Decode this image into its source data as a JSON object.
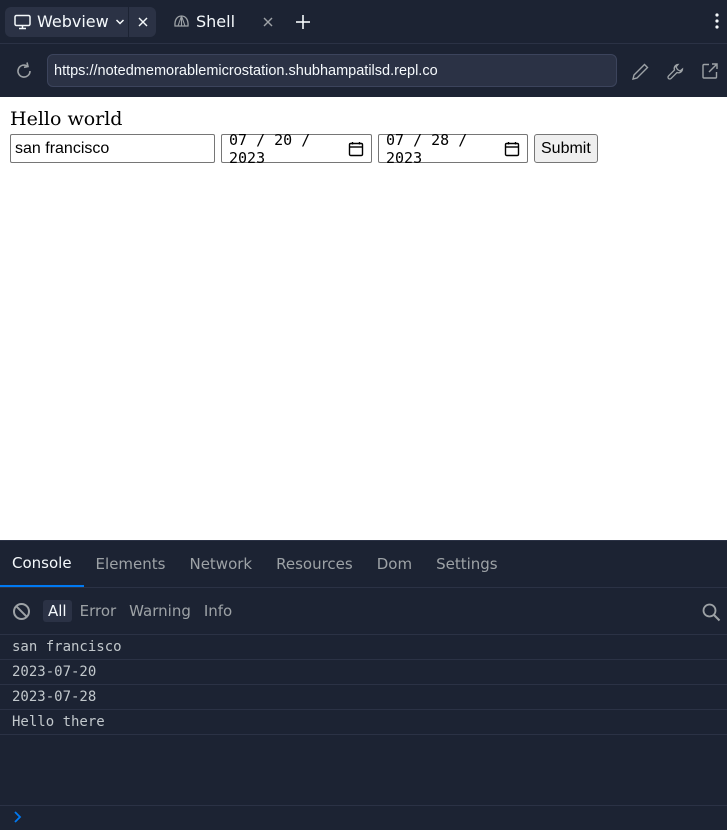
{
  "tabs": [
    {
      "label": "Webview",
      "icon": "monitor-icon",
      "active": true
    },
    {
      "label": "Shell",
      "icon": "shell-icon",
      "active": false
    }
  ],
  "url_bar": {
    "url": "https://notedmemorablemicrostation.shubhampatilsd.repl.co"
  },
  "page": {
    "heading": "Hello world",
    "city_value": "san francisco",
    "start_date": "07 / 20 / 2023",
    "end_date": "07 / 28 / 2023",
    "submit_label": "Submit"
  },
  "devtools": {
    "tabs": [
      "Console",
      "Elements",
      "Network",
      "Resources",
      "Dom",
      "Settings"
    ],
    "active_tab": "Console",
    "levels": [
      "All",
      "Error",
      "Warning",
      "Info"
    ],
    "active_level": "All",
    "logs": [
      "san francisco",
      "2023-07-20",
      "2023-07-28",
      "Hello there"
    ]
  },
  "colors": {
    "chrome_bg": "#1c2333",
    "panel_bg": "#2b3245",
    "accent": "#0079f2",
    "text": "#f5f9fc",
    "muted": "#9da2a6"
  }
}
